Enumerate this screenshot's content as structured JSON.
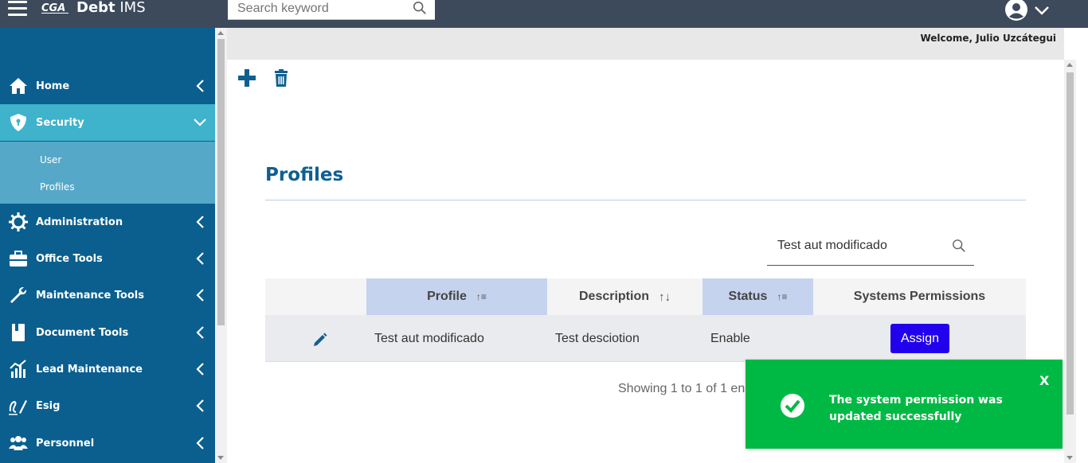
{
  "header": {
    "brand_strong": "Debt",
    "brand_light": "IMS",
    "search_placeholder": "Search keyword",
    "icons": {
      "menu": "hamburger-icon",
      "search": "search-icon",
      "user": "user-avatar-icon",
      "dropdown": "chevron-down-icon"
    }
  },
  "sidebar": {
    "items": [
      {
        "label": "Home",
        "icon": "home-icon"
      },
      {
        "label": "Security",
        "icon": "shield-icon"
      },
      {
        "label": "Administration",
        "icon": "gear-icon"
      },
      {
        "label": "Office Tools",
        "icon": "briefcase-icon"
      },
      {
        "label": "Maintenance Tools",
        "icon": "wrench-icon"
      },
      {
        "label": "Document Tools",
        "icon": "book-icon"
      },
      {
        "label": "Lead Maintenance",
        "icon": "bar-chart-icon"
      },
      {
        "label": "Esig",
        "icon": "signature-icon"
      },
      {
        "label": "Personnel",
        "icon": "people-icon"
      }
    ],
    "security_sub": [
      {
        "label": "User"
      },
      {
        "label": "Profiles"
      }
    ],
    "colors": {
      "background": "#0a5f8f",
      "active": "#3fb2cc",
      "submenu": "#56a8c8"
    }
  },
  "main": {
    "welcome": "Welcome, Julio Uzcátegui",
    "page_title": "Profiles",
    "filter_value": "Test aut modificado",
    "table": {
      "columns": [
        {
          "label": "Profile",
          "sort": "sorted-asc"
        },
        {
          "label": "Description",
          "sort": "sortable"
        },
        {
          "label": "Status",
          "sort": "sorted-asc"
        },
        {
          "label": "Systems Permissions",
          "sort": "none"
        }
      ],
      "rows": [
        {
          "profile": "Test aut modificado",
          "description": "Test desciotion",
          "status": "Enable",
          "action": "Assign"
        }
      ]
    },
    "info_text": "Showing 1 to 1 of 1 en"
  },
  "toast": {
    "close_label": "X",
    "message": "The system permission was updated successfully",
    "color": "#00b944"
  }
}
